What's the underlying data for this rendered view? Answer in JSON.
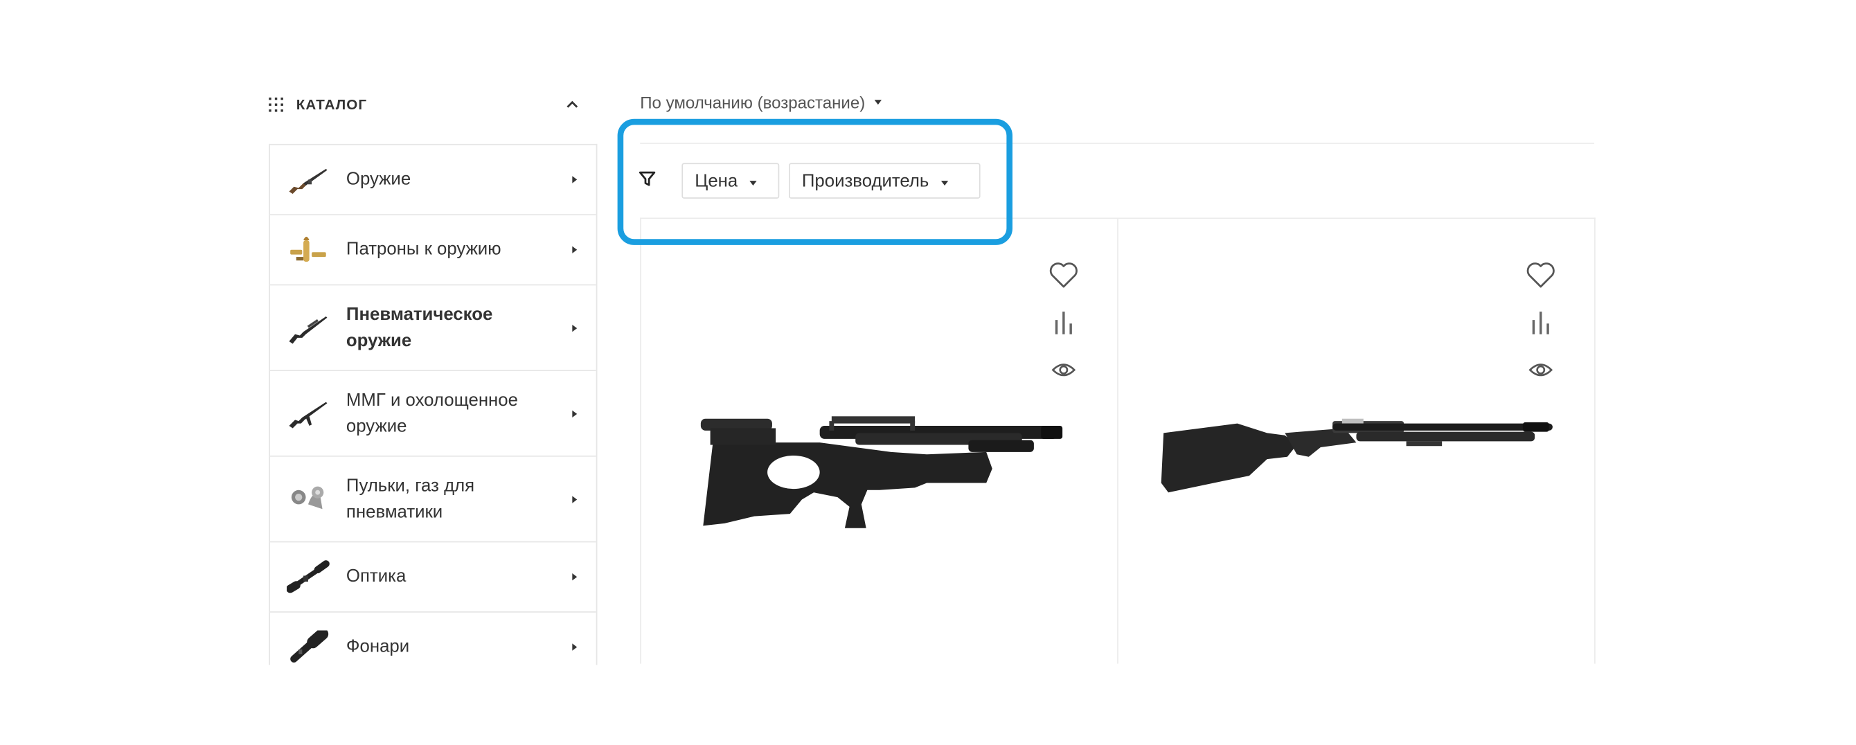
{
  "catalog": {
    "title": "КАТАЛОГ",
    "items": [
      {
        "label": "Оружие",
        "icon": "rifle-thumbnail",
        "bold": false
      },
      {
        "label": "Патроны к оружию",
        "icon": "cartridges-thumbnail",
        "bold": false
      },
      {
        "label": "Пневматическое оружие",
        "icon": "air-rifle-thumbnail",
        "bold": true
      },
      {
        "label": "ММГ и охолощенное оружие",
        "icon": "assault-rifle-thumbnail",
        "bold": false
      },
      {
        "label": "Пульки, газ для пневматики",
        "icon": "pellets-thumbnail",
        "bold": false
      },
      {
        "label": "Оптика",
        "icon": "scope-thumbnail",
        "bold": false
      },
      {
        "label": "Фонари",
        "icon": "flashlight-thumbnail",
        "bold": false
      }
    ]
  },
  "sort": {
    "label": "По умолчанию (возрастание)"
  },
  "filters": {
    "price_label": "Цена",
    "maker_label": "Производитель"
  },
  "highlight_color": "#1a9ee0",
  "products": [
    {
      "image": "bullpup-air-rifle",
      "actions": [
        "heart-icon",
        "compare-icon",
        "eye-icon"
      ]
    },
    {
      "image": "pcp-air-rifle",
      "actions": [
        "heart-icon",
        "compare-icon",
        "eye-icon"
      ]
    }
  ]
}
